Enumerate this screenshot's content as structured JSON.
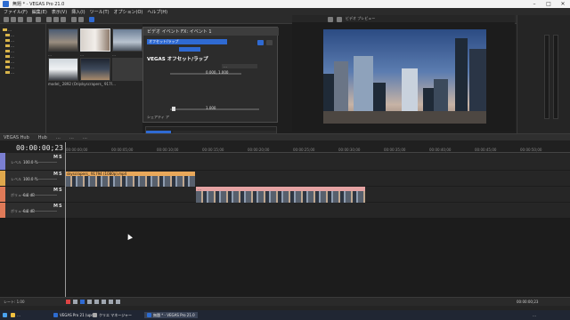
{
  "window": {
    "title": "無題 * - VEGAS Pro 21.0"
  },
  "menu": [
    "ファイル(F)",
    "編集(E)",
    "表示(V)",
    "挿入(I)",
    "ツール(T)",
    "オプション(O)",
    "ヘルプ(H)"
  ],
  "explorer": {
    "items": [
      "…",
      "…",
      "…",
      "…",
      "…",
      "…",
      "…",
      "…",
      "…"
    ]
  },
  "media": {
    "files": [
      {
        "label": "…"
      },
      {
        "label": "…"
      },
      {
        "label": "…"
      },
      {
        "label": "model_ 2892 (Original).mp4"
      },
      {
        "label": "skyscrapers_ 91794 (1080p).mp4"
      },
      {
        "label": "…"
      }
    ]
  },
  "fx_window": {
    "title": "ビデオ イベント FX: イベント 1",
    "tab": "オフセット/ラップ",
    "plugin_name": "VEGAS オフセット/ラップ",
    "dropdown": "…",
    "param_value_1": "0.000, 1.000",
    "param_value_2": "1.000",
    "section": "シェアティ ア"
  },
  "preview": {
    "title": "ビデオ プレビュー",
    "zoom": "…"
  },
  "tabs": [
    "VEGAS Hub",
    "Hub",
    "…",
    "…",
    "…"
  ],
  "timeline": {
    "timecode": "00:00:00;23",
    "ticks": [
      "00:00:00;00",
      "00:00:05;00",
      "00:00:10;00",
      "00:00:15;00",
      "00:00:20;00",
      "00:00:25;00",
      "00:00:30;00",
      "00:00:35;00",
      "00:00:40;00",
      "00:00:45;00",
      "00:00:50;00"
    ],
    "tracks": [
      {
        "label": "レベル",
        "value": "100.0 %",
        "color": "#7b7fd1"
      },
      {
        "label": "レベル",
        "value": "100.0 %",
        "color": "#e0a84c"
      },
      {
        "label": "ボリューム",
        "value": "0.0 dB",
        "color": "#e07a58"
      },
      {
        "label": "ボリューム",
        "value": "0.0 dB",
        "color": "#e07a58"
      }
    ],
    "clips": [
      {
        "label": "skyscrapers_ 91794 (1080p).mp4",
        "color": "#e9a85a"
      },
      {
        "label": "…",
        "color": "#e5a3a3"
      }
    ]
  },
  "transport": {
    "rate": "レート: 1.00",
    "end_time": "00:00:00;23"
  },
  "taskbar": {
    "items": [
      "…",
      "VEGAS Pro 21 (upd...",
      "クリエ マネージャー",
      "無題 * - VEGAS Pro 21.0"
    ],
    "clock": "…"
  }
}
